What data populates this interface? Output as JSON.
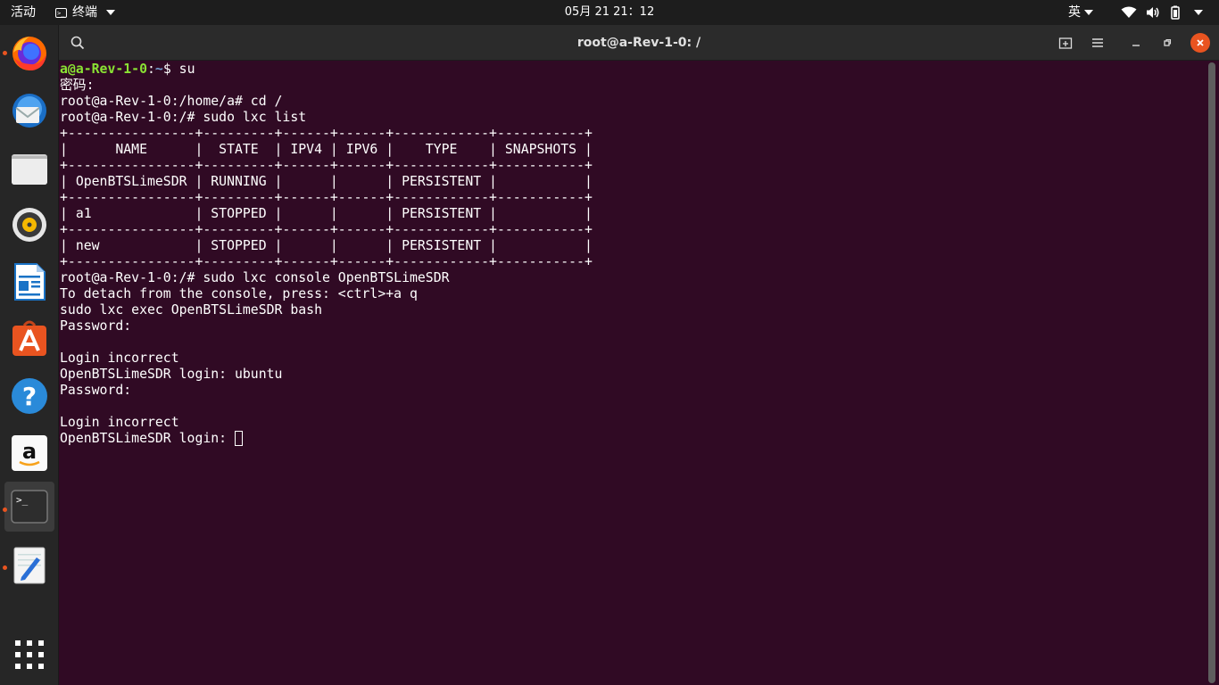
{
  "topbar": {
    "activities": "活动",
    "app_name": "终端",
    "clock": "05月 21  21：12",
    "language": "英"
  },
  "dock": {
    "items": [
      {
        "name": "firefox",
        "icon": "firefox-icon",
        "running": true
      },
      {
        "name": "thunderbird",
        "icon": "thunderbird-icon",
        "running": false
      },
      {
        "name": "files",
        "icon": "files-icon",
        "running": false
      },
      {
        "name": "rhythmbox",
        "icon": "rhythmbox-icon",
        "running": false
      },
      {
        "name": "libreoffice-writer",
        "icon": "writer-icon",
        "running": false
      },
      {
        "name": "ubuntu-software",
        "icon": "software-icon",
        "running": false
      },
      {
        "name": "help",
        "icon": "help-icon",
        "running": false
      },
      {
        "name": "amazon",
        "icon": "amazon-icon",
        "running": false
      },
      {
        "name": "terminal",
        "icon": "terminal-icon",
        "running": true,
        "active": true
      },
      {
        "name": "text-editor",
        "icon": "text-editor-icon",
        "running": true
      },
      {
        "name": "show-applications",
        "icon": "app-grid-icon",
        "running": false
      }
    ]
  },
  "window": {
    "title": "root@a-Rev-1-0: /"
  },
  "terminal": {
    "lines": [
      {
        "user": "a@a-Rev-1-0",
        "sep": ":",
        "path": "~",
        "rest": "$ su"
      },
      {
        "text": "密码:"
      },
      {
        "text": "root@a-Rev-1-0:/home/a# cd /"
      },
      {
        "text": "root@a-Rev-1-0:/# sudo lxc list"
      },
      {
        "text": "+----------------+---------+------+------+------------+-----------+"
      },
      {
        "text": "|      NAME      |  STATE  | IPV4 | IPV6 |    TYPE    | SNAPSHOTS |"
      },
      {
        "text": "+----------------+---------+------+------+------------+-----------+"
      },
      {
        "text": "| OpenBTSLimeSDR | RUNNING |      |      | PERSISTENT |           |"
      },
      {
        "text": "+----------------+---------+------+------+------------+-----------+"
      },
      {
        "text": "| a1             | STOPPED |      |      | PERSISTENT |           |"
      },
      {
        "text": "+----------------+---------+------+------+------------+-----------+"
      },
      {
        "text": "| new            | STOPPED |      |      | PERSISTENT |           |"
      },
      {
        "text": "+----------------+---------+------+------+------------+-----------+"
      },
      {
        "text": "root@a-Rev-1-0:/# sudo lxc console OpenBTSLimeSDR"
      },
      {
        "text": "To detach from the console, press: <ctrl>+a q"
      },
      {
        "text": "sudo lxc exec OpenBTSLimeSDR bash"
      },
      {
        "text": "Password:"
      },
      {
        "text": ""
      },
      {
        "text": "Login incorrect"
      },
      {
        "text": "OpenBTSLimeSDR login: ubuntu"
      },
      {
        "text": "Password:"
      },
      {
        "text": ""
      },
      {
        "text": "Login incorrect"
      },
      {
        "text": "OpenBTSLimeSDR login: ",
        "cursor": true
      }
    ]
  },
  "colors": {
    "terminal_bg": "#300a24",
    "prompt_user": "#8ae234",
    "prompt_path": "#729fcf",
    "accent": "#e95420"
  }
}
